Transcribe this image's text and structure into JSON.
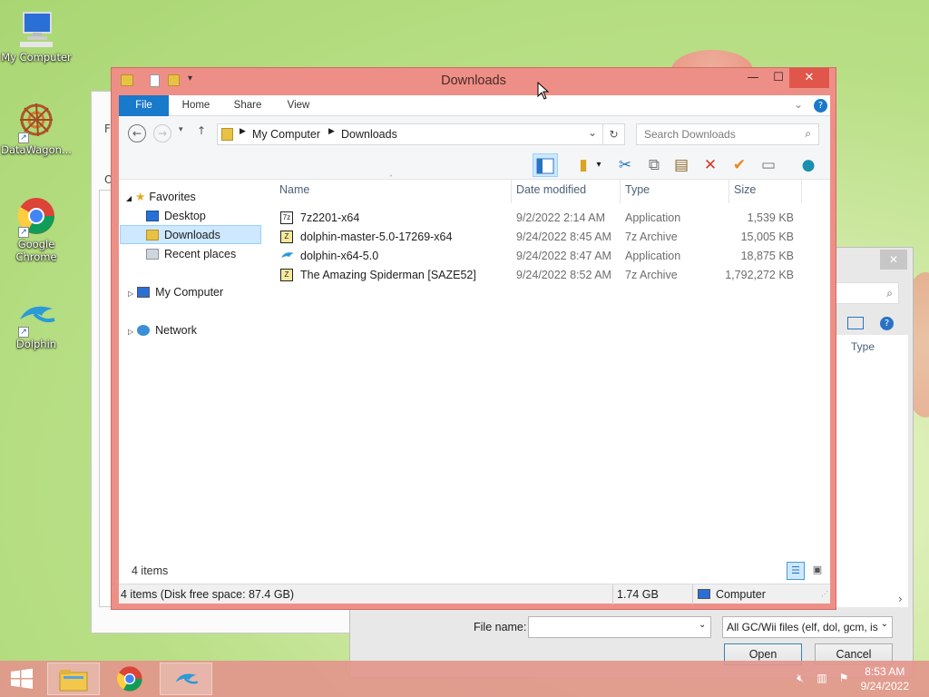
{
  "desktop": {
    "icons": [
      {
        "label": "My Computer"
      },
      {
        "label": "DataWagon..."
      },
      {
        "label": "Google Chrome"
      },
      {
        "label": "Dolphin"
      }
    ]
  },
  "background_dialog": {
    "file_name_label": "File name:",
    "file_name_value": "",
    "file_type": "All GC/Wii files (elf, dol, gcm, is",
    "open_label": "Open",
    "cancel_label": "Cancel",
    "column_type": "Type",
    "left_fragments": [
      "F",
      "O"
    ]
  },
  "window": {
    "title": "Downloads",
    "quick_access_dropdown": "▾",
    "controls": {
      "minimize": "—",
      "maximize": "☐",
      "close": "✕"
    },
    "ribbon_tabs": [
      "File",
      "Home",
      "Share",
      "View"
    ],
    "breadcrumb": [
      "My Computer",
      "Downloads"
    ],
    "search_placeholder": "Search Downloads",
    "nav": {
      "favorites": "Favorites",
      "desktop": "Desktop",
      "downloads": "Downloads",
      "recent": "Recent places",
      "computer": "My Computer",
      "network": "Network"
    },
    "columns": {
      "name": "Name",
      "date": "Date modified",
      "type": "Type",
      "size": "Size"
    },
    "files": [
      {
        "name": "7z2201-x64",
        "date": "9/2/2022 2:14 AM",
        "type": "Application",
        "size": "1,539 KB",
        "icon": "7zip-icon"
      },
      {
        "name": "dolphin-master-5.0-17269-x64",
        "date": "9/24/2022 8:45 AM",
        "type": "7z Archive",
        "size": "15,005 KB",
        "icon": "archive-icon"
      },
      {
        "name": "dolphin-x64-5.0",
        "date": "9/24/2022 8:47 AM",
        "type": "Application",
        "size": "18,875 KB",
        "icon": "dolphin-icon"
      },
      {
        "name": "The Amazing Spiderman [SAZE52]",
        "date": "9/24/2022 8:52 AM",
        "type": "7z Archive",
        "size": "1,792,272 KB",
        "icon": "archive-icon"
      }
    ],
    "item_count": "4 items",
    "status": {
      "summary": "4 items (Disk free space: 87.4 GB)",
      "size": "1.74 GB",
      "location": "Computer"
    }
  },
  "taskbar": {
    "time": "8:53 AM",
    "date": "9/24/2022"
  },
  "colors": {
    "accent": "#1979ca",
    "window_frame": "#ee8f87",
    "selection": "#cde8ff",
    "close_button": "#e0564b"
  }
}
